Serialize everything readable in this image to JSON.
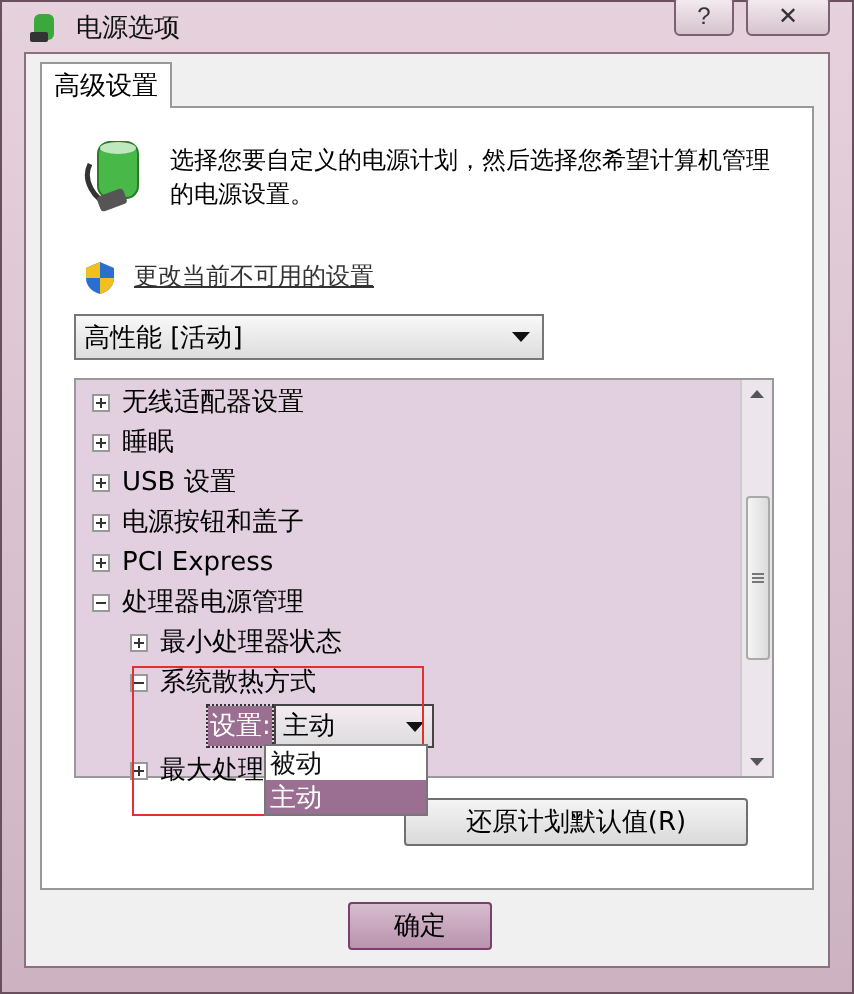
{
  "window": {
    "title": "电源选项",
    "buttons": [
      "?",
      "✕"
    ]
  },
  "tabs": [
    {
      "label": "高级设置",
      "selected": true
    }
  ],
  "intro": "选择您要自定义的电源计划，然后选择您希望计算机管理的电源设置。",
  "change_link": "更改当前不可用的设置",
  "plan_select": {
    "value": "高性能 [活动]"
  },
  "tree": [
    {
      "label": "无线适配器设置",
      "expanded": false
    },
    {
      "label": "睡眠",
      "expanded": false
    },
    {
      "label": "USB 设置",
      "expanded": false
    },
    {
      "label": "电源按钮和盖子",
      "expanded": false
    },
    {
      "label": "PCI Express",
      "expanded": false
    },
    {
      "label": "处理器电源管理",
      "expanded": true,
      "children": [
        {
          "label": "最小处理器状态",
          "expanded": false
        },
        {
          "label": "系统散热方式",
          "expanded": true,
          "setting": {
            "label": "设置:",
            "value": "主动",
            "options": [
              {
                "label": "被动",
                "selected": false
              },
              {
                "label": "主动",
                "selected": true
              }
            ]
          }
        },
        {
          "label": "最大处理",
          "expanded": false
        }
      ]
    }
  ],
  "restore_button": "还原计划默认值(R)",
  "ok_button": "确定"
}
